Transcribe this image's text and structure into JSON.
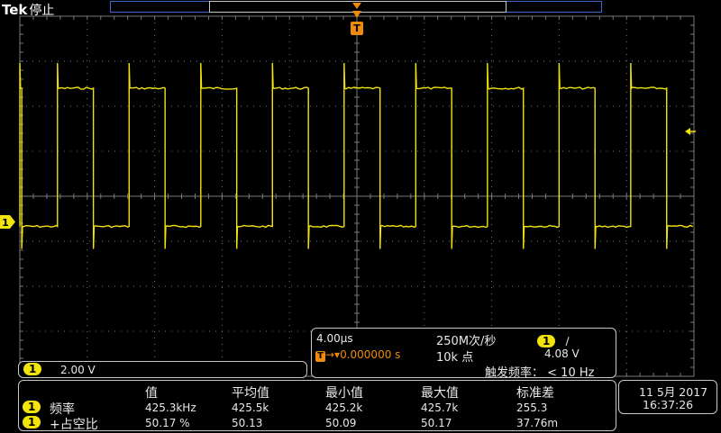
{
  "header": {
    "brand": "Tek",
    "status": "停止"
  },
  "trigger": {
    "marker_label": "T",
    "position_label": "0.000000 s",
    "level": "4.08 V",
    "rate_label": "触发频率：",
    "rate_value": "< 10 Hz",
    "slope_symbol": "∕"
  },
  "channel": {
    "id": "1",
    "vertical_scale": "2.00 V",
    "color": "#f2e30a"
  },
  "horizontal": {
    "time_per_div": "4.00µs",
    "sample_rate": "250M次/秒",
    "record_length": "10k 点"
  },
  "measurements": {
    "columns": [
      "值",
      "平均值",
      "最小值",
      "最大值",
      "标准差"
    ],
    "rows": [
      {
        "channel": "1",
        "label": "频率",
        "values": [
          "425.3kHz",
          "425.5k",
          "425.2k",
          "425.7k",
          "255.3"
        ]
      },
      {
        "channel": "1",
        "label": "+占空比",
        "values": [
          "50.17 %",
          "50.13",
          "50.09",
          "50.17",
          "37.76m"
        ]
      }
    ]
  },
  "datetime": {
    "date": "11 5月 2017",
    "time": "16:37:26"
  },
  "waveform": {
    "type": "square",
    "period_divisions": 1.063,
    "high_divisions": 2.4,
    "low_divisions": -0.67,
    "duty_cycle_percent": 50.17
  },
  "colors": {
    "trace": "#f2e30a",
    "trigger": "#f08a0a",
    "grid": "#7a7a7a",
    "record_bar": "#3a6bc9"
  }
}
